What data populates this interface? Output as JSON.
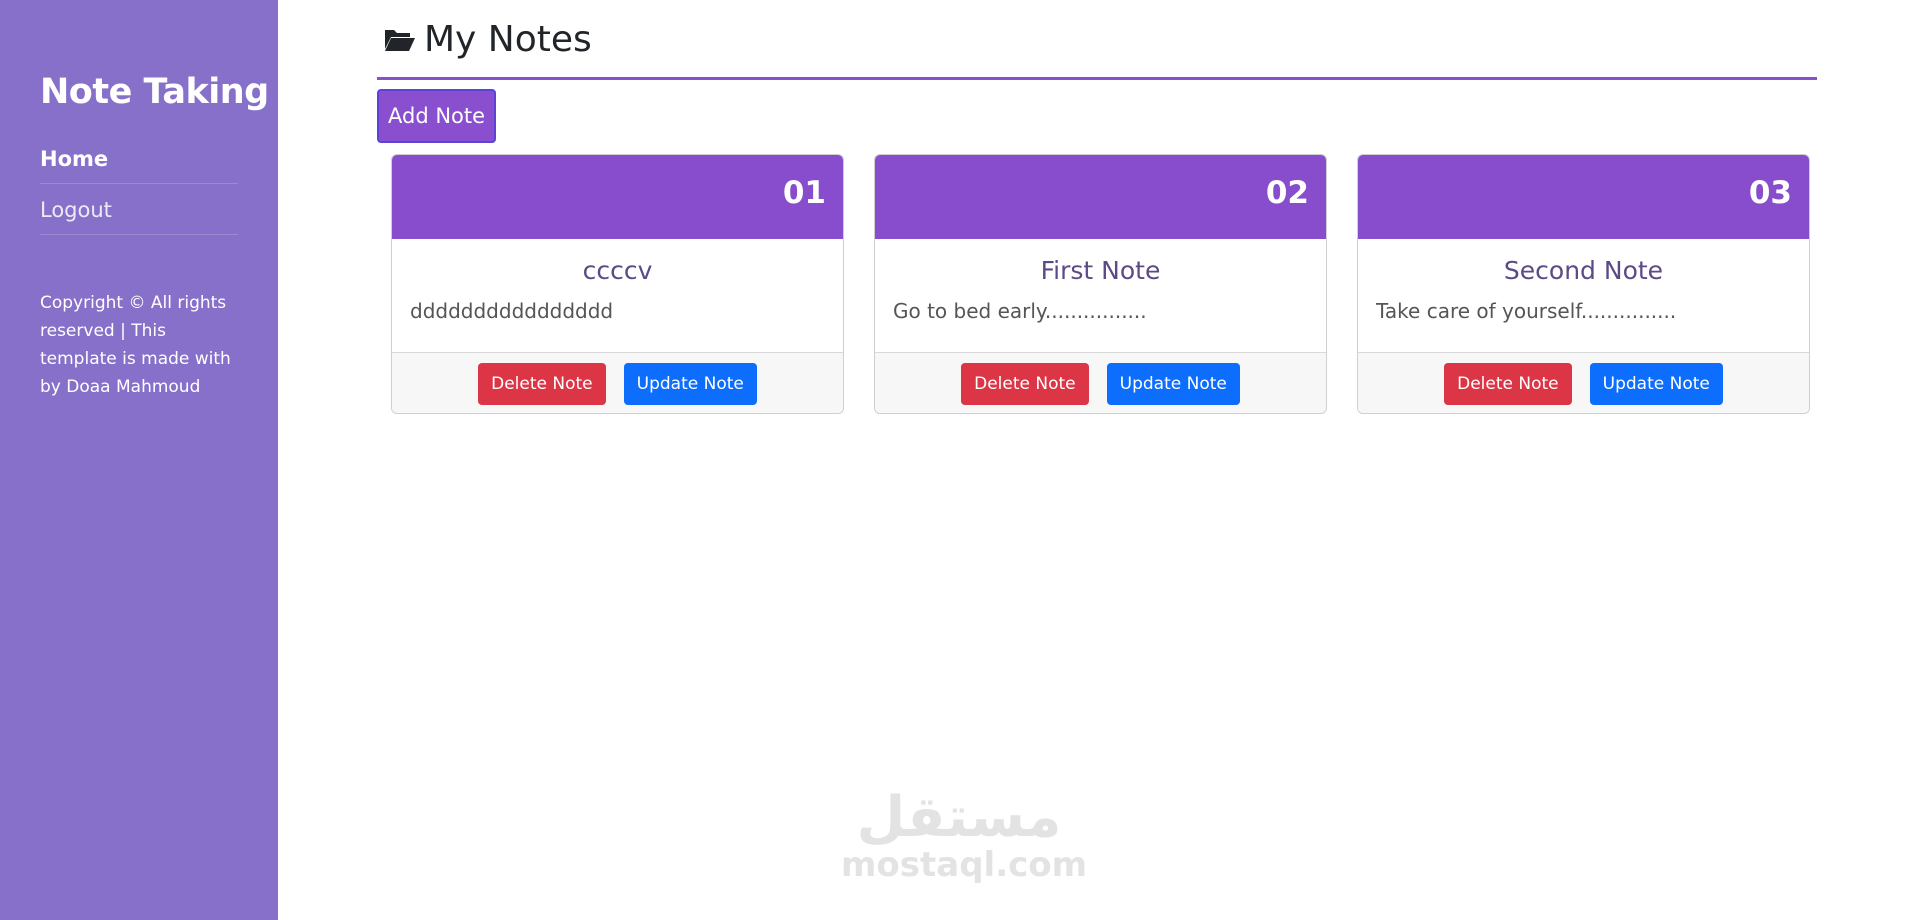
{
  "sidebar": {
    "brand": "Note Taking",
    "nav": [
      {
        "label": "Home"
      },
      {
        "label": "Logout"
      }
    ],
    "copyright": "Copyright © All rights reserved | This template is made with by Doaa Mahmoud"
  },
  "header": {
    "icon": "folder-open-icon",
    "title": "My Notes",
    "add_button": "Add Note"
  },
  "notes": [
    {
      "number": "01",
      "title": "ccccv",
      "text": "dddddddddddddddd",
      "delete_label": "Delete Note",
      "update_label": "Update Note"
    },
    {
      "number": "02",
      "title": "First Note",
      "text": "Go to bed early................",
      "delete_label": "Delete Note",
      "update_label": "Update Note"
    },
    {
      "number": "03",
      "title": "Second Note",
      "text": "Take care of yourself...............",
      "delete_label": "Delete Note",
      "update_label": "Update Note"
    }
  ],
  "watermark": {
    "arabic": "مستقل",
    "latin": "mostaql.com"
  },
  "colors": {
    "sidebar": "#8770c9",
    "accent": "#874dcc",
    "danger": "#dc3545",
    "primary": "#0d6efd"
  }
}
